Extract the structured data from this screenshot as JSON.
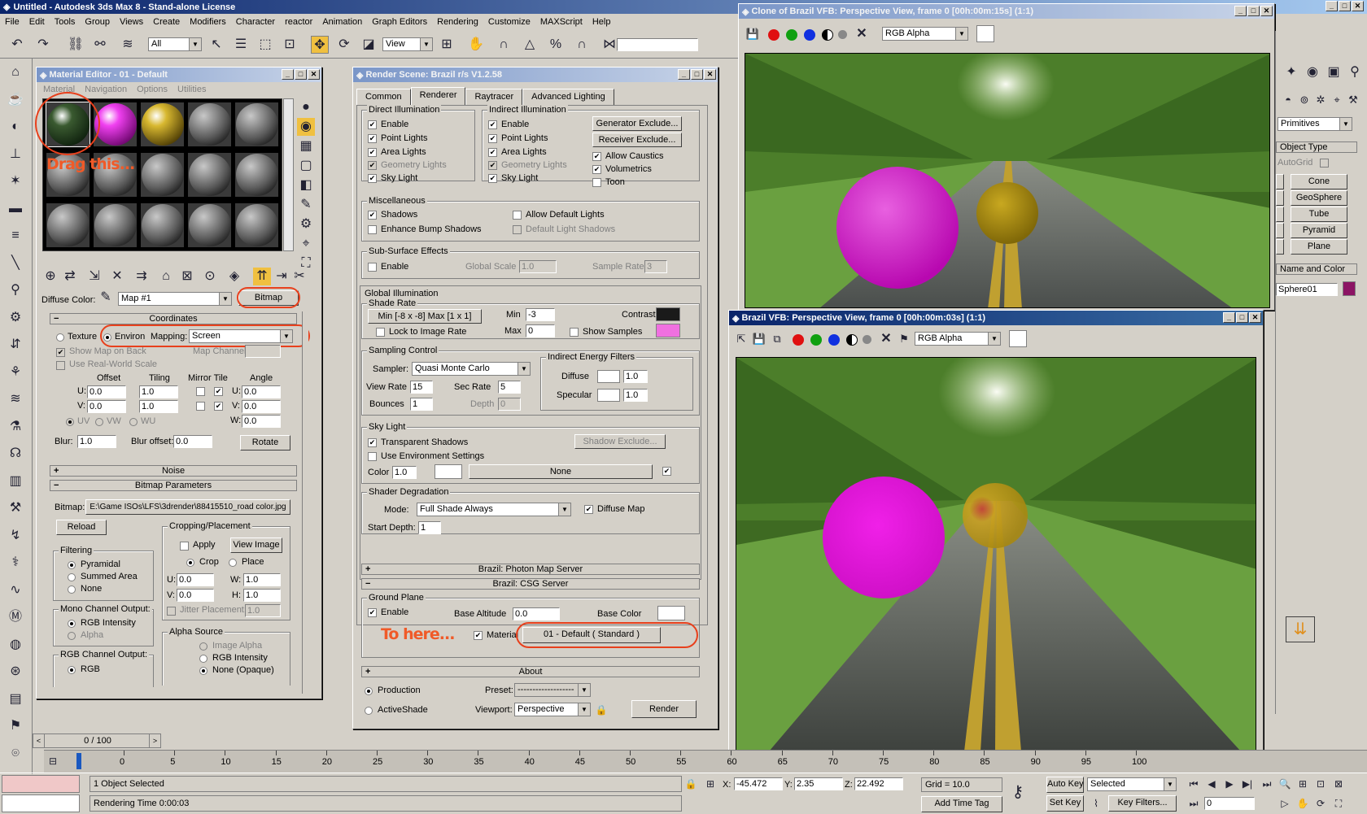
{
  "app": {
    "title": "Untitled - Autodesk 3ds Max 8 - Stand-alone License",
    "menu": [
      "File",
      "Edit",
      "Tools",
      "Group",
      "Views",
      "Create",
      "Modifiers",
      "Character",
      "reactor",
      "Animation",
      "Graph Editors",
      "Rendering",
      "Customize",
      "MAXScript",
      "Help"
    ],
    "selection_filter": "All",
    "ref_coord": "View"
  },
  "material_editor": {
    "title": "Material Editor - 01 - Default",
    "menu": [
      "Material",
      "Navigation",
      "Options",
      "Utilities"
    ],
    "diffuse_label": "Diffuse Color:",
    "map_name": "Map #1",
    "map_type": "Bitmap",
    "coords": {
      "header": "Coordinates",
      "texture": "Texture",
      "environ": "Environ",
      "mapping_label": "Mapping:",
      "mapping": "Screen",
      "show_map_on_back": "Show Map on Back",
      "map_channel": "Map Channel:",
      "use_real_world": "Use Real-World Scale",
      "offset": "Offset",
      "tiling": "Tiling",
      "mirror_tile": "Mirror Tile",
      "angle": "Angle",
      "u": "U:",
      "v": "V:",
      "w": "W:",
      "u_offset": "0.0",
      "v_offset": "0.0",
      "u_tiling": "1.0",
      "v_tiling": "1.0",
      "u_angle": "0.0",
      "v_angle": "0.0",
      "w_angle": "0.0",
      "uv": "UV",
      "vw": "VW",
      "wu": "WU",
      "blur_label": "Blur:",
      "blur": "1.0",
      "blur_offset_label": "Blur offset:",
      "blur_offset": "0.0",
      "rotate": "Rotate"
    },
    "noise": "Noise",
    "bitmap_params": "Bitmap Parameters",
    "bitmap_label": "Bitmap:",
    "bitmap_path": "E:\\Game ISOs\\LFS\\3drender\\88415510_road color.jpg",
    "reload": "Reload",
    "cropping": "Cropping/Placement",
    "apply": "Apply",
    "view_image": "View Image",
    "crop": "Crop",
    "place": "Place",
    "cu": "0.0",
    "cv": "0.0",
    "cw": "1.0",
    "ch": "1.0",
    "h": "H:",
    "jitter": "Jitter Placement:",
    "jitter_val": "1.0",
    "filtering": "Filtering",
    "pyramidal": "Pyramidal",
    "summed_area": "Summed Area",
    "none": "None",
    "mono": "Mono Channel Output:",
    "rgb_intensity": "RGB Intensity",
    "alpha": "Alpha",
    "alpha_source": "Alpha Source",
    "image_alpha": "Image Alpha",
    "rgb_intensity2": "RGB Intensity",
    "none_opaque": "None (Opaque)",
    "rgb_channel": "RGB Channel Output:",
    "rgb": "RGB",
    "annotation": "Drag this..."
  },
  "render_scene": {
    "title": "Render Scene: Brazil r/s V1.2.58",
    "tabs": [
      "Common",
      "Renderer",
      "Raytracer",
      "Advanced Lighting"
    ],
    "direct": "Direct Illumination",
    "indirect": "Indirect Illumination",
    "enable": "Enable",
    "point_lights": "Point Lights",
    "area_lights": "Area Lights",
    "geometry_lights": "Geometry Lights",
    "sky_light": "Sky Light",
    "gen_exclude": "Generator Exclude...",
    "rec_exclude": "Receiver Exclude...",
    "allow_caustics": "Allow Caustics",
    "volumetrics": "Volumetrics",
    "toon": "Toon",
    "misc": "Miscellaneous",
    "shadows": "Shadows",
    "allow_default": "Allow Default Lights",
    "enhance_bump": "Enhance Bump Shadows",
    "default_shadows": "Default Light Shadows",
    "sss": "Sub-Surface Effects",
    "global_scale": "Global Scale",
    "global_scale_val": "1.0",
    "sample_rate": "Sample Rate",
    "sample_rate_val": "3",
    "gi": "Global Illumination",
    "shade_rate": "Shade Rate",
    "minmax": "Min [-8 x -8]  Max [1 x 1]",
    "min": "Min",
    "min_val": "-3",
    "max": "Max",
    "max_val": "0",
    "contrast": "Contrast",
    "lock": "Lock to Image Rate",
    "show_samples": "Show Samples",
    "sampling": "Sampling Control",
    "sampler": "Sampler:",
    "sampler_val": "Quasi Monte Carlo",
    "view_rate": "View Rate",
    "view_rate_val": "15",
    "sec_rate": "Sec Rate",
    "sec_rate_val": "5",
    "bounces": "Bounces",
    "bounces_val": "1",
    "depth": "Depth",
    "depth_val": "0",
    "ief": "Indirect Energy Filters",
    "diffuse": "Diffuse",
    "diffuse_val": "1.0",
    "specular": "Specular",
    "specular_val": "1.0",
    "skylight": "Sky Light",
    "transparent": "Transparent Shadows",
    "shadow_exclude": "Shadow Exclude...",
    "use_env": "Use Environment Settings",
    "color": "Color",
    "color_val": "1.0",
    "none": "None",
    "shader_deg": "Shader Degradation",
    "mode": "Mode:",
    "mode_val": "Full Shade Always",
    "diffuse_map": "Diffuse Map",
    "start_depth": "Start Depth:",
    "start_depth_val": "1",
    "photon": "Brazil: Photon Map Server",
    "csg": "Brazil: CSG Server",
    "ground": "Ground Plane",
    "base_alt": "Base Altitude",
    "base_alt_val": "0.0",
    "base_color": "Base Color",
    "material": "Material",
    "material_val": "01 - Default  ( Standard )",
    "annotation": "To here...",
    "about": "About",
    "production": "Production",
    "activeshade": "ActiveShade",
    "preset": "Preset:",
    "preset_val": "-------------------",
    "viewport": "Viewport:",
    "viewport_val": "Perspective",
    "render": "Render"
  },
  "vfb_clone": {
    "title": "Clone of Brazil VFB: Perspective View, frame 0 [00h:00m:15s] (1:1)",
    "channel": "RGB Alpha"
  },
  "vfb": {
    "title": "Brazil VFB: Perspective View, frame 0 [00h:00m:03s] (1:1)",
    "channel": "RGB Alpha"
  },
  "command_panel": {
    "dropdown": "Primitives",
    "object_type": "Object Type",
    "autogrid": "AutoGrid",
    "buttons": [
      "Cone",
      "GeoSphere",
      "Tube",
      "Pyramid",
      "Plane"
    ],
    "name_color": "Name and Color",
    "name": "Sphere01"
  },
  "timeline": {
    "frame": "0 / 100",
    "ticks": [
      "0",
      "5",
      "10",
      "15",
      "20",
      "25",
      "30",
      "35",
      "40",
      "45",
      "50",
      "55",
      "60",
      "65",
      "70",
      "75",
      "80",
      "85",
      "90",
      "95",
      "100"
    ]
  },
  "status": {
    "selected": "1 Object Selected",
    "render_time": "Rendering Time  0:00:03",
    "x": "-45.472",
    "y": "2.35",
    "z": "22.492",
    "grid": "Grid = 10.0",
    "auto_key": "Auto Key",
    "set_key": "Set Key",
    "selected_dd": "Selected",
    "key_filters": "Key Filters...",
    "add_time_tag": "Add Time Tag",
    "frame_val": "0"
  },
  "colors": {
    "accent": "#0a246a",
    "annotation": "#e8401c",
    "magenta": "#d816c8",
    "gold": "#a88a10"
  }
}
